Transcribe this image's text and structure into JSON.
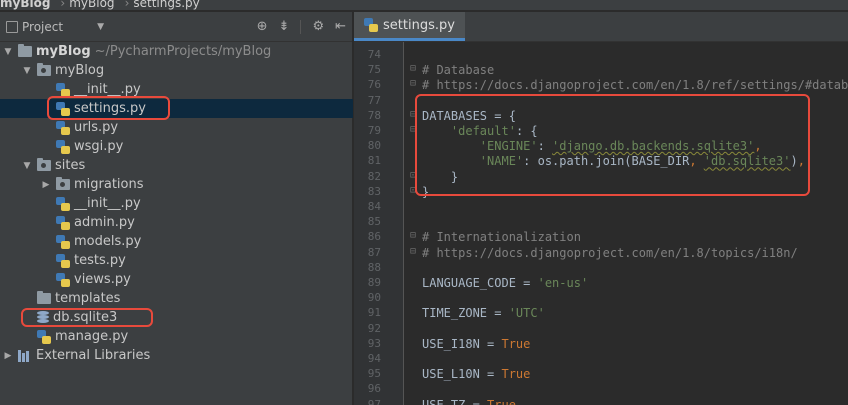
{
  "breadcrumbs": [
    "myBlog",
    "myBlog",
    "settings.py"
  ],
  "project_panel": {
    "title": "Project",
    "tree": [
      {
        "depth": 0,
        "arrow": "down",
        "type": "folder",
        "label": "myBlog",
        "path": "~/PycharmProjects/myBlog",
        "bold": true
      },
      {
        "depth": 1,
        "arrow": "down",
        "type": "pkg",
        "label": "myBlog"
      },
      {
        "depth": 2,
        "arrow": "",
        "type": "py",
        "label": "__init__.py"
      },
      {
        "depth": 2,
        "arrow": "",
        "type": "py",
        "label": "settings.py",
        "selected": true
      },
      {
        "depth": 2,
        "arrow": "",
        "type": "py",
        "label": "urls.py"
      },
      {
        "depth": 2,
        "arrow": "",
        "type": "py",
        "label": "wsgi.py"
      },
      {
        "depth": 1,
        "arrow": "down",
        "type": "pkg",
        "label": "sites"
      },
      {
        "depth": 2,
        "arrow": "right",
        "type": "pkg",
        "label": "migrations"
      },
      {
        "depth": 2,
        "arrow": "",
        "type": "py",
        "label": "__init__.py"
      },
      {
        "depth": 2,
        "arrow": "",
        "type": "py",
        "label": "admin.py"
      },
      {
        "depth": 2,
        "arrow": "",
        "type": "py",
        "label": "models.py"
      },
      {
        "depth": 2,
        "arrow": "",
        "type": "py",
        "label": "tests.py"
      },
      {
        "depth": 2,
        "arrow": "",
        "type": "py",
        "label": "views.py"
      },
      {
        "depth": 1,
        "arrow": "",
        "type": "folder",
        "label": "templates"
      },
      {
        "depth": 1,
        "arrow": "",
        "type": "db",
        "label": "db.sqlite3"
      },
      {
        "depth": 1,
        "arrow": "",
        "type": "py",
        "label": "manage.py"
      },
      {
        "depth": 0,
        "arrow": "right",
        "type": "lib",
        "label": "External Libraries"
      }
    ]
  },
  "editor": {
    "tab_label": "settings.py",
    "lines": [
      {
        "n": "74",
        "fold": "",
        "tokens": []
      },
      {
        "n": "75",
        "fold": "⊟",
        "tokens": [
          [
            "cm",
            "# Database"
          ]
        ]
      },
      {
        "n": "76",
        "fold": "⊟",
        "tokens": [
          [
            "cm",
            "# https://docs.djangoproject.com/en/1.8/ref/settings/#databases"
          ]
        ]
      },
      {
        "n": "77",
        "fold": "",
        "tokens": []
      },
      {
        "n": "78",
        "fold": "⊟",
        "tokens": [
          [
            "plain",
            "DATABASES = {"
          ]
        ]
      },
      {
        "n": "79",
        "fold": "⊟",
        "tokens": [
          [
            "plain",
            "    "
          ],
          [
            "str",
            "'default'"
          ],
          [
            "plain",
            ": {"
          ]
        ]
      },
      {
        "n": "80",
        "fold": "",
        "tokens": [
          [
            "plain",
            "        "
          ],
          [
            "str",
            "'ENGINE'"
          ],
          [
            "plain",
            ": "
          ],
          [
            "str",
            "'django.db.backends.sqlite3'"
          ],
          [
            "kw",
            ","
          ]
        ]
      },
      {
        "n": "81",
        "fold": "",
        "tokens": [
          [
            "plain",
            "        "
          ],
          [
            "str",
            "'NAME'"
          ],
          [
            "plain",
            ": os.path.join(BASE_DIR"
          ],
          [
            "kw",
            ", "
          ],
          [
            "str",
            "'db.sqlite3'"
          ],
          [
            "plain",
            ")"
          ],
          [
            "kw",
            ","
          ]
        ]
      },
      {
        "n": "82",
        "fold": "⊡",
        "tokens": [
          [
            "plain",
            "    }"
          ]
        ]
      },
      {
        "n": "83",
        "fold": "⊡",
        "tokens": [
          [
            "plain",
            "}"
          ]
        ]
      },
      {
        "n": "84",
        "fold": "",
        "tokens": []
      },
      {
        "n": "85",
        "fold": "",
        "tokens": []
      },
      {
        "n": "86",
        "fold": "⊟",
        "tokens": [
          [
            "cm",
            "# Internationalization"
          ]
        ]
      },
      {
        "n": "87",
        "fold": "⊟",
        "tokens": [
          [
            "cm",
            "# https://docs.djangoproject.com/en/1.8/topics/i18n/"
          ]
        ]
      },
      {
        "n": "88",
        "fold": "",
        "tokens": []
      },
      {
        "n": "89",
        "fold": "",
        "tokens": [
          [
            "plain",
            "LANGUAGE_CODE = "
          ],
          [
            "str",
            "'en-us'"
          ]
        ]
      },
      {
        "n": "90",
        "fold": "",
        "tokens": []
      },
      {
        "n": "91",
        "fold": "",
        "tokens": [
          [
            "plain",
            "TIME_ZONE = "
          ],
          [
            "str",
            "'UTC'"
          ]
        ]
      },
      {
        "n": "92",
        "fold": "",
        "tokens": []
      },
      {
        "n": "93",
        "fold": "",
        "tokens": [
          [
            "plain",
            "USE_I18N = "
          ],
          [
            "kw",
            "True"
          ]
        ]
      },
      {
        "n": "94",
        "fold": "",
        "tokens": []
      },
      {
        "n": "95",
        "fold": "",
        "tokens": [
          [
            "plain",
            "USE_L10N = "
          ],
          [
            "kw",
            "True"
          ]
        ]
      },
      {
        "n": "96",
        "fold": "",
        "tokens": []
      },
      {
        "n": "97",
        "fold": "",
        "tokens": [
          [
            "plain",
            "USE_TZ = "
          ],
          [
            "kw",
            "True"
          ]
        ]
      }
    ]
  },
  "colors": {
    "highlight_box": "#e84a3c",
    "selection": "#0d293e",
    "tab_underline": "#4a88c7"
  }
}
